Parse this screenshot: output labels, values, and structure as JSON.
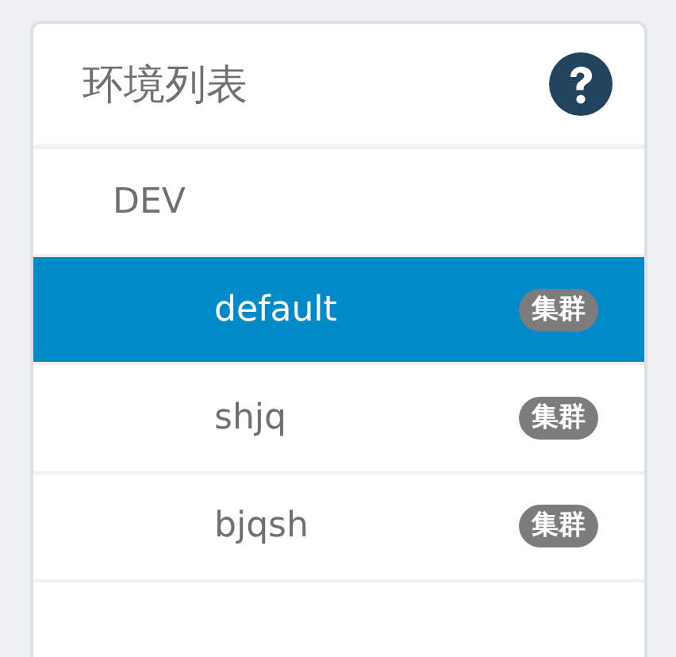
{
  "panel": {
    "title": "环境列表"
  },
  "tree": [
    {
      "label": "DEV",
      "selected": false,
      "children": [
        {
          "label": "default",
          "badge": "集群",
          "selected": true
        },
        {
          "label": "shjq",
          "badge": "集群",
          "selected": false
        },
        {
          "label": "bjqsh",
          "badge": "集群",
          "selected": false
        }
      ]
    }
  ]
}
